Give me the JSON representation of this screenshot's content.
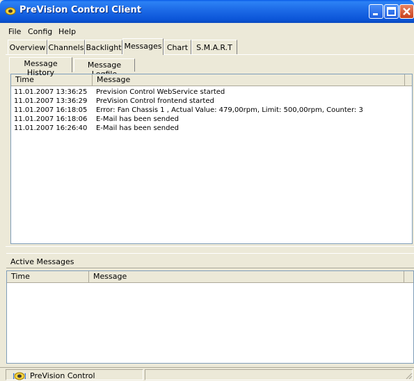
{
  "window": {
    "title": "PreVision Control Client",
    "accent": "#0a5ce8",
    "icon": "app-logo-icon"
  },
  "menu": [
    "File",
    "Config",
    "Help"
  ],
  "tabs": [
    "Overview",
    "Channels",
    "Backlight",
    "Messages",
    "Chart",
    "S.M.A.R.T"
  ],
  "active_tab": "Messages",
  "subtabs": [
    "Message History",
    "Message Logfile"
  ],
  "active_subtab": "Message History",
  "history": {
    "columns": [
      "Time",
      "Message"
    ],
    "rows": [
      [
        "11.01.2007 13:36:25",
        "Prevision Control WebService started"
      ],
      [
        "11.01.2007 13:36:29",
        "PreVision Control frontend started"
      ],
      [
        "11.01.2007 16:18:05",
        "Error: Fan Chassis 1 , Actual Value: 479,00rpm, Limit: 500,00rpm, Counter: 3"
      ],
      [
        "11.01.2007 16:18:06",
        "E-Mail has been sended"
      ],
      [
        "11.01.2007 16:26:40",
        "E-Mail has been sended"
      ]
    ]
  },
  "active_messages": {
    "label": "Active Messages",
    "columns": [
      "Time",
      "Message"
    ]
  },
  "status": {
    "text": "PreVision Control"
  }
}
